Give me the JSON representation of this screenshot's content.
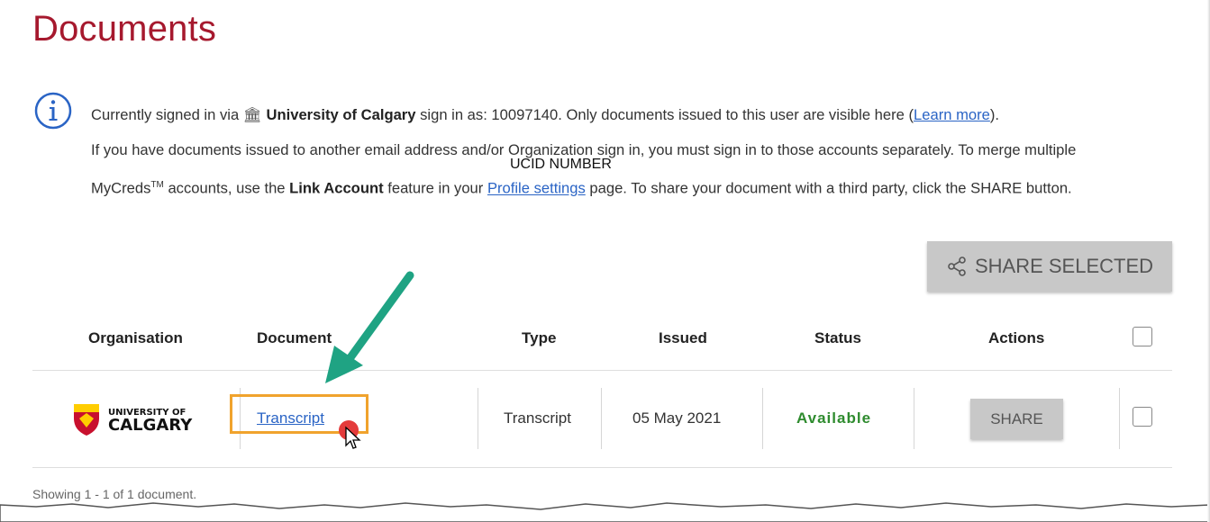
{
  "page": {
    "title": "Documents"
  },
  "info": {
    "line1_prefix": "Currently signed in via ",
    "institution": "University of Calgary",
    "line1_mid": " sign in as: 10097140. Only documents issued to this user are visible here (",
    "learn_more": "Learn more",
    "line1_end": ").",
    "line2": "If you have documents issued to another email address and/or Organization sign in, you must sign in to those accounts separately. To merge multiple",
    "line3_prefix": "MyCreds",
    "trademark": "TM",
    "line3_mid": " accounts, use the ",
    "link_account": "Link Account",
    "line3_mid2": " feature in your ",
    "profile_settings": "Profile settings",
    "line3_end": " page. To share your document with a third party, click the SHARE button."
  },
  "annotation": {
    "ucid_label": "UCID NUMBER"
  },
  "toolbar": {
    "share_selected_label": "SHARE SELECTED"
  },
  "table": {
    "headers": [
      "Organisation",
      "Document",
      "Type",
      "Issued",
      "Status",
      "Actions"
    ],
    "rows": [
      {
        "organisation_logo": {
          "line1": "UNIVERSITY OF",
          "line2": "CALGARY"
        },
        "document": "Transcript",
        "type": "Transcript",
        "issued": "05 May 2021",
        "status": "Available",
        "action_label": "SHARE"
      }
    ]
  },
  "footer": {
    "count_text": "Showing 1 - 1 of 1 document."
  },
  "colors": {
    "title_red": "#a6192e",
    "link_blue": "#2a64c5",
    "status_green": "#2e8b2e",
    "highlight_orange": "#f0a32d",
    "arrow_teal": "#1fa383",
    "button_gray": "#c8c8c8"
  },
  "icons": [
    "info-icon",
    "bank-icon",
    "share-icon",
    "arrow-annotation",
    "cursor-icon"
  ]
}
